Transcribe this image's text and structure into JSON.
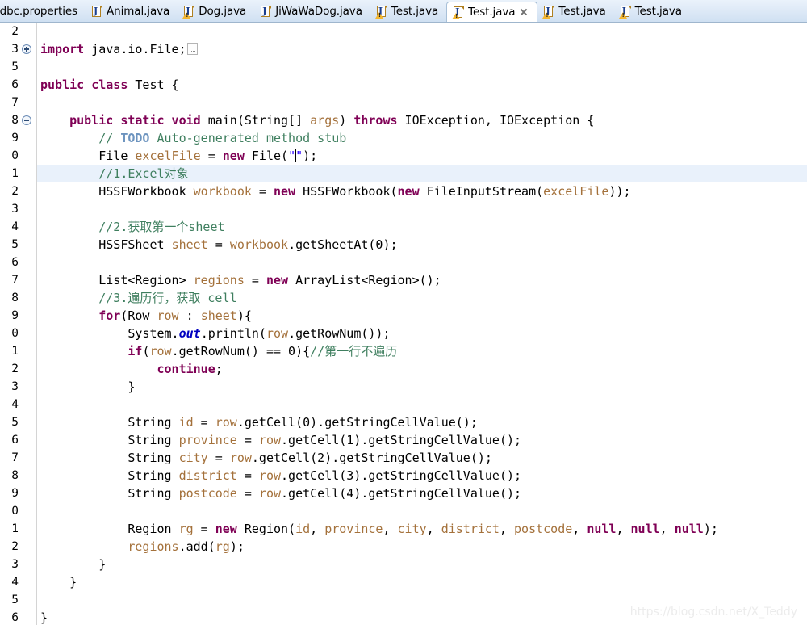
{
  "tabs": [
    {
      "label": "jdbc.properties",
      "icon": "properties-file-icon",
      "active": false,
      "warning": false,
      "closable": false
    },
    {
      "label": "Animal.java",
      "icon": "java-file-icon",
      "active": false,
      "warning": false,
      "closable": false
    },
    {
      "label": "Dog.java",
      "icon": "java-file-warning-icon",
      "active": false,
      "warning": true,
      "closable": false
    },
    {
      "label": "JiWaWaDog.java",
      "icon": "java-file-icon",
      "active": false,
      "warning": false,
      "closable": false
    },
    {
      "label": "Test.java",
      "icon": "java-file-warning-icon",
      "active": false,
      "warning": true,
      "closable": false
    },
    {
      "label": "Test.java",
      "icon": "java-file-warning-icon",
      "active": true,
      "warning": true,
      "closable": true
    },
    {
      "label": "Test.java",
      "icon": "java-file-warning-icon",
      "active": false,
      "warning": true,
      "closable": false
    },
    {
      "label": "Test.java",
      "icon": "java-file-warning-icon",
      "active": false,
      "warning": true,
      "closable": false
    }
  ],
  "editor": {
    "watermark": "https://blog.csdn.net/X_Teddy",
    "current_line_index": 8,
    "gutter": [
      {
        "number": "2",
        "fold": ""
      },
      {
        "number": "3",
        "fold": "plus"
      },
      {
        "number": "5",
        "fold": ""
      },
      {
        "number": "6",
        "fold": ""
      },
      {
        "number": "7",
        "fold": ""
      },
      {
        "number": "8",
        "fold": "minus"
      },
      {
        "number": "9",
        "fold": ""
      },
      {
        "number": "0",
        "fold": ""
      },
      {
        "number": "1",
        "fold": ""
      },
      {
        "number": "2",
        "fold": ""
      },
      {
        "number": "3",
        "fold": ""
      },
      {
        "number": "4",
        "fold": ""
      },
      {
        "number": "5",
        "fold": ""
      },
      {
        "number": "6",
        "fold": ""
      },
      {
        "number": "7",
        "fold": ""
      },
      {
        "number": "8",
        "fold": ""
      },
      {
        "number": "9",
        "fold": ""
      },
      {
        "number": "0",
        "fold": ""
      },
      {
        "number": "1",
        "fold": ""
      },
      {
        "number": "2",
        "fold": ""
      },
      {
        "number": "3",
        "fold": ""
      },
      {
        "number": "4",
        "fold": ""
      },
      {
        "number": "5",
        "fold": ""
      },
      {
        "number": "6",
        "fold": ""
      },
      {
        "number": "7",
        "fold": ""
      },
      {
        "number": "8",
        "fold": ""
      },
      {
        "number": "9",
        "fold": ""
      },
      {
        "number": "0",
        "fold": ""
      },
      {
        "number": "1",
        "fold": ""
      },
      {
        "number": "2",
        "fold": ""
      },
      {
        "number": "3",
        "fold": ""
      },
      {
        "number": "4",
        "fold": ""
      },
      {
        "number": "5",
        "fold": ""
      },
      {
        "number": "6",
        "fold": ""
      }
    ],
    "lines": [
      {
        "text": "",
        "tokens": []
      },
      {
        "text": "import java.io.File;⎕",
        "tokens": [
          {
            "t": "import",
            "c": "kw"
          },
          {
            "t": " java.io.File;",
            "c": "plain"
          },
          {
            "t": "",
            "c": "collapsed"
          }
        ]
      },
      {
        "text": "",
        "tokens": []
      },
      {
        "text": "public class Test {",
        "tokens": [
          {
            "t": "public class ",
            "c": "kw"
          },
          {
            "t": "Test {",
            "c": "plain"
          }
        ]
      },
      {
        "text": "",
        "tokens": []
      },
      {
        "text": "    public static void main(String[] args) throws IOException, IOException {",
        "tokens": [
          {
            "t": "    ",
            "c": "plain"
          },
          {
            "t": "public static void ",
            "c": "kw"
          },
          {
            "t": "main(String[] ",
            "c": "plain"
          },
          {
            "t": "args",
            "c": "local"
          },
          {
            "t": ") ",
            "c": "plain"
          },
          {
            "t": "throws",
            "c": "kw"
          },
          {
            "t": " IOException, IOException {",
            "c": "plain"
          }
        ]
      },
      {
        "text": "        // TODO Auto-generated method stub",
        "tokens": [
          {
            "t": "        ",
            "c": "plain"
          },
          {
            "t": "// ",
            "c": "cmt"
          },
          {
            "t": "TODO",
            "c": "tdo"
          },
          {
            "t": " Auto-generated method stub",
            "c": "cmt"
          }
        ]
      },
      {
        "text": "        File excelFile = new File(\"\");",
        "tokens": [
          {
            "t": "        File ",
            "c": "plain"
          },
          {
            "t": "excelFile",
            "c": "local"
          },
          {
            "t": " = ",
            "c": "plain"
          },
          {
            "t": "new",
            "c": "kw"
          },
          {
            "t": " File(",
            "c": "plain"
          },
          {
            "t": "\"",
            "c": "str"
          },
          {
            "t": "",
            "c": "caret"
          },
          {
            "t": "\"",
            "c": "str"
          },
          {
            "t": ");",
            "c": "plain"
          }
        ]
      },
      {
        "text": "        //1.Excel对象",
        "tokens": [
          {
            "t": "        ",
            "c": "plain"
          },
          {
            "t": "//1.Excel对象",
            "c": "cmt"
          }
        ]
      },
      {
        "text": "        HSSFWorkbook workbook = new HSSFWorkbook(new FileInputStream(excelFile));",
        "tokens": [
          {
            "t": "        HSSFWorkbook ",
            "c": "plain"
          },
          {
            "t": "workbook",
            "c": "local"
          },
          {
            "t": " = ",
            "c": "plain"
          },
          {
            "t": "new",
            "c": "kw"
          },
          {
            "t": " HSSFWorkbook(",
            "c": "plain"
          },
          {
            "t": "new",
            "c": "kw"
          },
          {
            "t": " FileInputStream(",
            "c": "plain"
          },
          {
            "t": "excelFile",
            "c": "local"
          },
          {
            "t": "));",
            "c": "plain"
          }
        ]
      },
      {
        "text": "",
        "tokens": []
      },
      {
        "text": "        //2.获取第一个sheet",
        "tokens": [
          {
            "t": "        ",
            "c": "plain"
          },
          {
            "t": "//2.获取第一个sheet",
            "c": "cmt"
          }
        ]
      },
      {
        "text": "        HSSFSheet sheet = workbook.getSheetAt(0);",
        "tokens": [
          {
            "t": "        HSSFSheet ",
            "c": "plain"
          },
          {
            "t": "sheet",
            "c": "local"
          },
          {
            "t": " = ",
            "c": "plain"
          },
          {
            "t": "workbook",
            "c": "local"
          },
          {
            "t": ".getSheetAt(0);",
            "c": "plain"
          }
        ]
      },
      {
        "text": "",
        "tokens": []
      },
      {
        "text": "        List<Region> regions = new ArrayList<Region>();",
        "tokens": [
          {
            "t": "        List<Region> ",
            "c": "plain"
          },
          {
            "t": "regions",
            "c": "local"
          },
          {
            "t": " = ",
            "c": "plain"
          },
          {
            "t": "new",
            "c": "kw"
          },
          {
            "t": " ArrayList<Region>();",
            "c": "plain"
          }
        ]
      },
      {
        "text": "        //3.遍历行，获取 cell",
        "tokens": [
          {
            "t": "        ",
            "c": "plain"
          },
          {
            "t": "//3.遍历行，获取 cell",
            "c": "cmt"
          }
        ]
      },
      {
        "text": "        for(Row row : sheet){",
        "tokens": [
          {
            "t": "        ",
            "c": "plain"
          },
          {
            "t": "for",
            "c": "kw"
          },
          {
            "t": "(Row ",
            "c": "plain"
          },
          {
            "t": "row",
            "c": "local"
          },
          {
            "t": " : ",
            "c": "plain"
          },
          {
            "t": "sheet",
            "c": "local"
          },
          {
            "t": "){",
            "c": "plain"
          }
        ]
      },
      {
        "text": "            System.out.println(row.getRowNum());",
        "tokens": [
          {
            "t": "            System.",
            "c": "plain"
          },
          {
            "t": "out",
            "c": "field"
          },
          {
            "t": ".println(",
            "c": "plain"
          },
          {
            "t": "row",
            "c": "local"
          },
          {
            "t": ".getRowNum());",
            "c": "plain"
          }
        ]
      },
      {
        "text": "            if(row.getRowNum() == 0){//第一行不遍历",
        "tokens": [
          {
            "t": "            ",
            "c": "plain"
          },
          {
            "t": "if",
            "c": "kw"
          },
          {
            "t": "(",
            "c": "plain"
          },
          {
            "t": "row",
            "c": "local"
          },
          {
            "t": ".getRowNum() == 0){",
            "c": "plain"
          },
          {
            "t": "//第一行不遍历",
            "c": "cmt"
          }
        ]
      },
      {
        "text": "                continue;",
        "tokens": [
          {
            "t": "                ",
            "c": "plain"
          },
          {
            "t": "continue",
            "c": "kw"
          },
          {
            "t": ";",
            "c": "plain"
          }
        ]
      },
      {
        "text": "            }",
        "tokens": [
          {
            "t": "            }",
            "c": "plain"
          }
        ]
      },
      {
        "text": "",
        "tokens": []
      },
      {
        "text": "            String id = row.getCell(0).getStringCellValue();",
        "tokens": [
          {
            "t": "            String ",
            "c": "plain"
          },
          {
            "t": "id",
            "c": "local"
          },
          {
            "t": " = ",
            "c": "plain"
          },
          {
            "t": "row",
            "c": "local"
          },
          {
            "t": ".getCell(0).getStringCellValue();",
            "c": "plain"
          }
        ]
      },
      {
        "text": "            String province = row.getCell(1).getStringCellValue();",
        "tokens": [
          {
            "t": "            String ",
            "c": "plain"
          },
          {
            "t": "province",
            "c": "local"
          },
          {
            "t": " = ",
            "c": "plain"
          },
          {
            "t": "row",
            "c": "local"
          },
          {
            "t": ".getCell(1).getStringCellValue();",
            "c": "plain"
          }
        ]
      },
      {
        "text": "            String city = row.getCell(2).getStringCellValue();",
        "tokens": [
          {
            "t": "            String ",
            "c": "plain"
          },
          {
            "t": "city",
            "c": "local"
          },
          {
            "t": " = ",
            "c": "plain"
          },
          {
            "t": "row",
            "c": "local"
          },
          {
            "t": ".getCell(2).getStringCellValue();",
            "c": "plain"
          }
        ]
      },
      {
        "text": "            String district = row.getCell(3).getStringCellValue();",
        "tokens": [
          {
            "t": "            String ",
            "c": "plain"
          },
          {
            "t": "district",
            "c": "local"
          },
          {
            "t": " = ",
            "c": "plain"
          },
          {
            "t": "row",
            "c": "local"
          },
          {
            "t": ".getCell(3).getStringCellValue();",
            "c": "plain"
          }
        ]
      },
      {
        "text": "            String postcode = row.getCell(4).getStringCellValue();",
        "tokens": [
          {
            "t": "            String ",
            "c": "plain"
          },
          {
            "t": "postcode",
            "c": "local"
          },
          {
            "t": " = ",
            "c": "plain"
          },
          {
            "t": "row",
            "c": "local"
          },
          {
            "t": ".getCell(4).getStringCellValue();",
            "c": "plain"
          }
        ]
      },
      {
        "text": "",
        "tokens": []
      },
      {
        "text": "            Region rg = new Region(id, province, city, district, postcode, null, null, null);",
        "tokens": [
          {
            "t": "            Region ",
            "c": "plain"
          },
          {
            "t": "rg",
            "c": "local"
          },
          {
            "t": " = ",
            "c": "plain"
          },
          {
            "t": "new",
            "c": "kw"
          },
          {
            "t": " Region(",
            "c": "plain"
          },
          {
            "t": "id",
            "c": "local"
          },
          {
            "t": ", ",
            "c": "plain"
          },
          {
            "t": "province",
            "c": "local"
          },
          {
            "t": ", ",
            "c": "plain"
          },
          {
            "t": "city",
            "c": "local"
          },
          {
            "t": ", ",
            "c": "plain"
          },
          {
            "t": "district",
            "c": "local"
          },
          {
            "t": ", ",
            "c": "plain"
          },
          {
            "t": "postcode",
            "c": "local"
          },
          {
            "t": ", ",
            "c": "plain"
          },
          {
            "t": "null",
            "c": "kw"
          },
          {
            "t": ", ",
            "c": "plain"
          },
          {
            "t": "null",
            "c": "kw"
          },
          {
            "t": ", ",
            "c": "plain"
          },
          {
            "t": "null",
            "c": "kw"
          },
          {
            "t": ");",
            "c": "plain"
          }
        ]
      },
      {
        "text": "            regions.add(rg);",
        "tokens": [
          {
            "t": "            ",
            "c": "plain"
          },
          {
            "t": "regions",
            "c": "local"
          },
          {
            "t": ".add(",
            "c": "plain"
          },
          {
            "t": "rg",
            "c": "local"
          },
          {
            "t": ");",
            "c": "plain"
          }
        ]
      },
      {
        "text": "        }",
        "tokens": [
          {
            "t": "        }",
            "c": "plain"
          }
        ]
      },
      {
        "text": "    }",
        "tokens": [
          {
            "t": "    }",
            "c": "plain"
          }
        ]
      },
      {
        "text": "",
        "tokens": []
      },
      {
        "text": "}",
        "tokens": [
          {
            "t": "}",
            "c": "plain"
          }
        ]
      }
    ]
  },
  "colors": {
    "keyword": "#7f0055",
    "comment": "#3f7f5f",
    "todo": "#6d94bf",
    "string": "#2a00ff",
    "local_variable": "#a4713b",
    "static_field": "#0000c0",
    "current_line_bg": "#e9f1fb",
    "tab_bar_bg": "#dfeaf7",
    "active_tab_bg": "#ffffff",
    "gutter_text": "#8a8a8a"
  }
}
